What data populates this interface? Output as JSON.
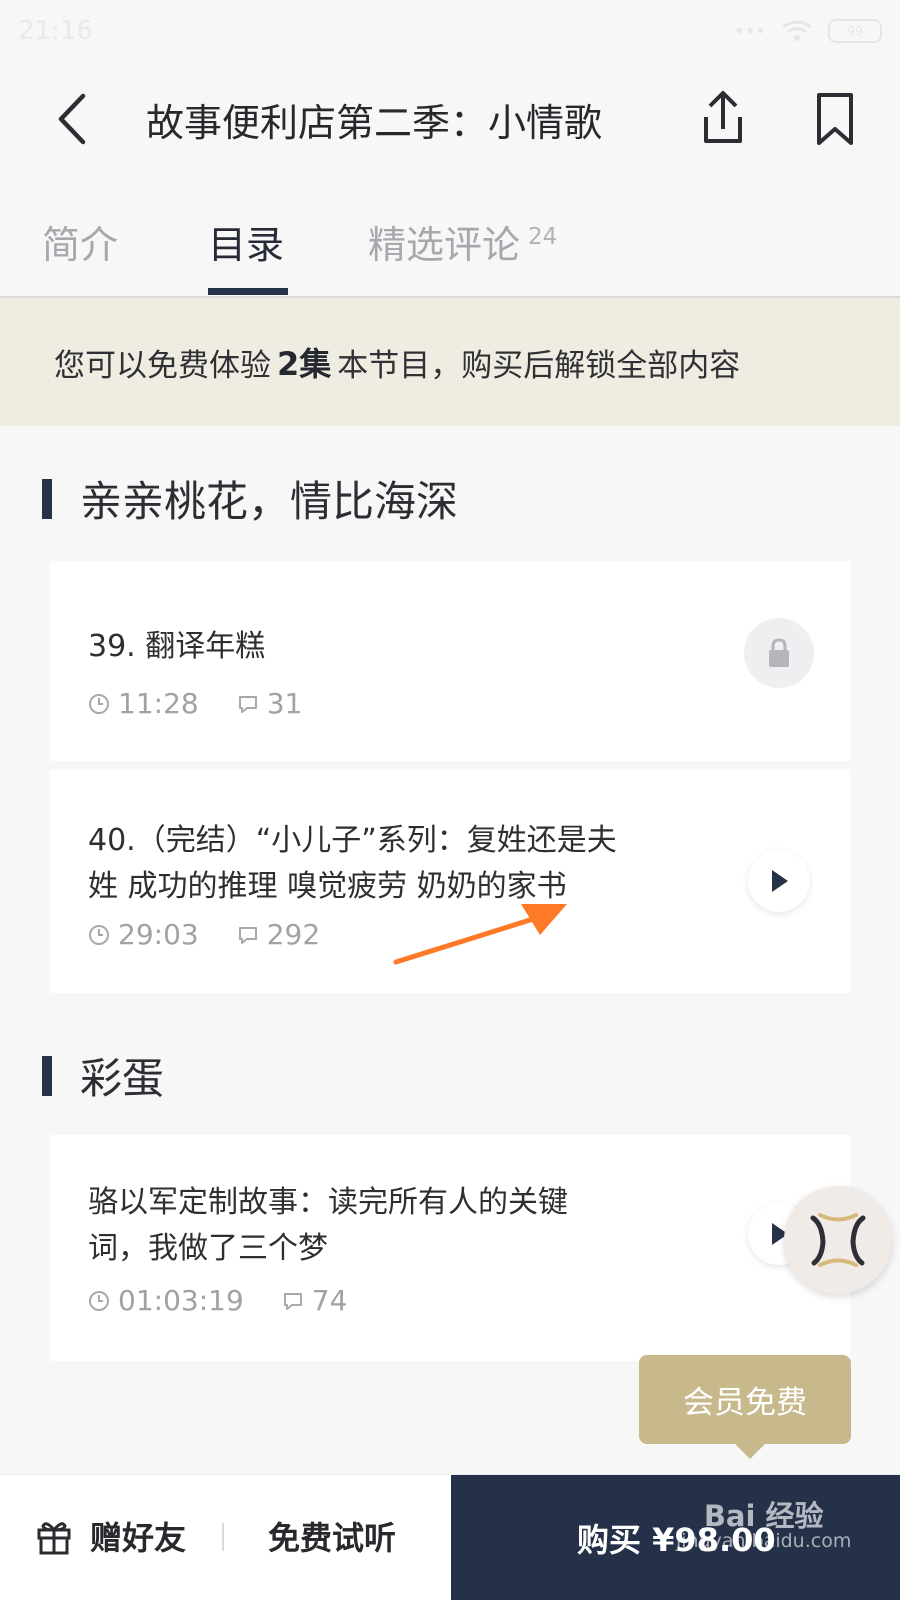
{
  "status_bar": {
    "time": "21:16",
    "battery": "99"
  },
  "header": {
    "title": "故事便利店第二季：小情歌"
  },
  "tabs": [
    {
      "label": "简介",
      "count": ""
    },
    {
      "label": "目录",
      "count": ""
    },
    {
      "label": "精选评论",
      "count": "24"
    }
  ],
  "free_banner": {
    "text_before": "您可以免费体验",
    "highlight": "2集",
    "text_after": "本节目，购买后解锁全部内容"
  },
  "sections": [
    {
      "title": "亲亲桃花，情比海深",
      "episodes": [
        {
          "title": "39. 翻译年糕",
          "duration": "11:28",
          "comments": "31",
          "state": "locked"
        },
        {
          "title": "40.（完结）“小儿子”系列：复姓还是夫\n姓 成功的推理 嗅觉疲劳 奶奶的家书",
          "duration": "29:03",
          "comments": "292",
          "state": "playable"
        }
      ]
    },
    {
      "title": "彩蛋",
      "episodes": [
        {
          "title": "骆以军定制故事：读完所有人的关键\n词，我做了三个梦",
          "duration": "01:03:19",
          "comments": "74",
          "state": "playable"
        }
      ]
    }
  ],
  "member_tooltip": {
    "label": "会员免费"
  },
  "bottom_bar": {
    "gift_label": "赠好友",
    "trial_label": "免费试听",
    "buy_label": "购买 ¥98.00"
  },
  "watermark": {
    "brand": "Bai 经验",
    "domain": "jingyan.baidu.com"
  },
  "colors": {
    "page_background": "#f7f7f8",
    "banner_background": "#efece2",
    "accent_navy": "#263247",
    "member_gold": "#c7b98c",
    "annotation_orange": "#ff7a26"
  },
  "icons": {
    "back": "chevron-left-icon",
    "share": "share-icon",
    "bookmark": "bookmark-icon",
    "duration": "clock-icon",
    "comments": "comment-icon",
    "locked": "lock-icon",
    "play": "play-icon",
    "gift": "gift-icon"
  }
}
